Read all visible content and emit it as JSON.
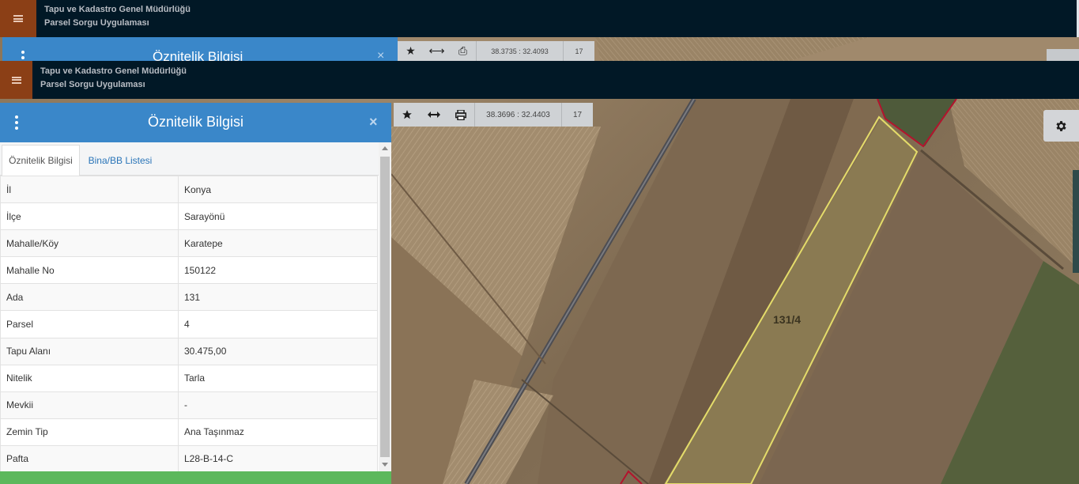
{
  "app": {
    "title_line1": "Tapu ve Kadastro Genel Müdürlüğü",
    "title_line2": "Parsel Sorgu Uygulaması",
    "colors": {
      "header": "#011826",
      "menu": "#8b3f16",
      "panel_header": "#3a87c9",
      "footer": "#5cb85c"
    }
  },
  "ghost": {
    "panel_title": "Öznitelik Bilgisi",
    "close_label": "×",
    "coords": "38.3735 : 32.4093",
    "zoom": "17"
  },
  "toolbar": {
    "coords": "38.3696 : 32.4403",
    "zoom": "17",
    "icons": [
      "star-icon",
      "arrows-horizontal-icon",
      "print-icon"
    ],
    "settings_icon": "gear-icon"
  },
  "panel": {
    "title": "Öznitelik Bilgisi",
    "close_label": "×",
    "tabs": [
      {
        "label": "Öznitelik Bilgisi",
        "active": true
      },
      {
        "label": "Bina/BB Listesi",
        "active": false
      }
    ],
    "rows": [
      {
        "key": "İl",
        "value": "Konya"
      },
      {
        "key": "İlçe",
        "value": "Sarayönü"
      },
      {
        "key": "Mahalle/Köy",
        "value": "Karatepe"
      },
      {
        "key": "Mahalle No",
        "value": "150122"
      },
      {
        "key": "Ada",
        "value": "131"
      },
      {
        "key": "Parsel",
        "value": "4"
      },
      {
        "key": "Tapu Alanı",
        "value": "30.475,00"
      },
      {
        "key": "Nitelik",
        "value": "Tarla"
      },
      {
        "key": "Mevkii",
        "value": "-"
      },
      {
        "key": "Zemin Tip",
        "value": "Ana Taşınmaz"
      },
      {
        "key": "Pafta",
        "value": "L28-B-14-C"
      }
    ]
  },
  "map": {
    "parcel_label": "131/4"
  }
}
